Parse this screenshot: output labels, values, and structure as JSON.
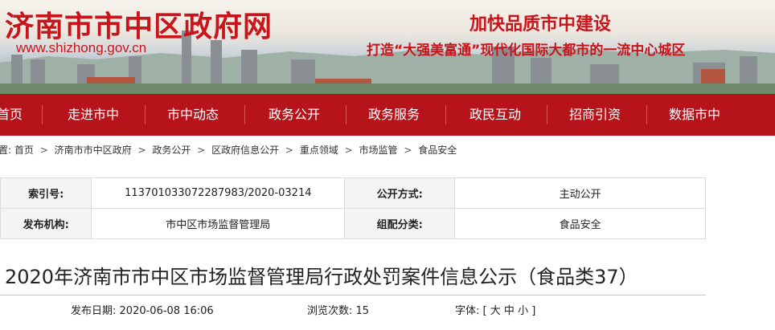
{
  "header": {
    "site_title": "济南市市中区政府网",
    "site_url": "www.shizhong.gov.cn",
    "slogan_main": "加快品质市中建设",
    "slogan_sub": "打造“大强美富通”现代化国际大都市的一流中心城区"
  },
  "nav": {
    "items": [
      "首页",
      "走进市中",
      "市中动态",
      "政务公开",
      "政务服务",
      "政民互动",
      "招商引资",
      "数据市中"
    ]
  },
  "breadcrumb": {
    "prefix": "位置:",
    "items": [
      "首页",
      "济南市市中区政府",
      "政务公开",
      "区政府信息公开",
      "重点领域",
      "市场监管",
      "食品安全"
    ],
    "separator": ">"
  },
  "info": {
    "index_label": "索引号:",
    "index_value": "113701033072287983/2020-03214",
    "method_label": "公开方式:",
    "method_value": "主动公开",
    "publisher_label": "发布机构:",
    "publisher_value": "市中区市场监督管理局",
    "category_label": "组配分类:",
    "category_value": "食品安全"
  },
  "article": {
    "title": "2020年济南市市中区市场监督管理局行政处罚案件信息公示（食品类37）",
    "date_label": "发布日期:",
    "date_value": "2020-06-08 16:06",
    "views_label": "浏览次数:",
    "views_value": "15",
    "font_label": "字体:",
    "font_open": "[",
    "font_large": "大",
    "font_medium": "中",
    "font_small": "小",
    "font_close": "]"
  },
  "colors": {
    "brand_red": "#c8141a",
    "nav_red": "#b6131b"
  }
}
